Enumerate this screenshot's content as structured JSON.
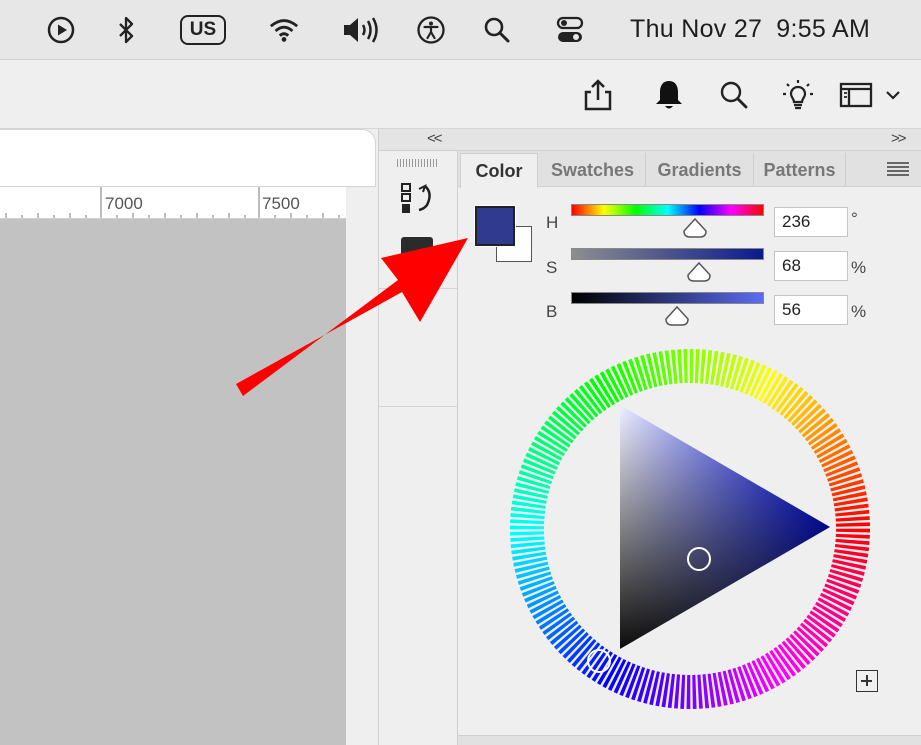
{
  "menubar": {
    "icons": [
      "play-circle-icon",
      "bluetooth-icon",
      "wifi-icon",
      "volume-icon",
      "accessibility-icon",
      "spotlight-search-icon",
      "control-center-icon"
    ],
    "keyboard_layout": "US",
    "date": "Thu Nov 27",
    "time": "9:55 AM"
  },
  "optionsbar": {
    "icons": [
      "share-icon",
      "bell-icon",
      "search-icon",
      "lightbulb-icon",
      "workspace-icon",
      "chevron-down-icon"
    ]
  },
  "ruler": {
    "labels": [
      "7000",
      "7500"
    ]
  },
  "dock": {
    "collapse_left": "<<",
    "collapse_right": ">>",
    "icons": [
      "history-icon",
      "color-swatch-icon"
    ]
  },
  "color_panel": {
    "tabs": [
      {
        "label": "Color",
        "active": true
      },
      {
        "label": "Swatches",
        "active": false
      },
      {
        "label": "Gradients",
        "active": false
      },
      {
        "label": "Patterns",
        "active": false
      }
    ],
    "foreground_color": "#303A8F",
    "background_color": "#FFFFFF",
    "sliders": [
      {
        "label": "H",
        "value": "236",
        "unit": "°",
        "fraction": 0.66
      },
      {
        "label": "S",
        "value": "68",
        "unit": "%",
        "fraction": 0.68
      },
      {
        "label": "B",
        "value": "56",
        "unit": "%",
        "fraction": 0.56
      }
    ],
    "hue_wheel_selected_hue_deg": 236,
    "add_button_icon": "add-swatch-icon"
  },
  "annotation": {
    "arrow_color": "#FF0000"
  }
}
